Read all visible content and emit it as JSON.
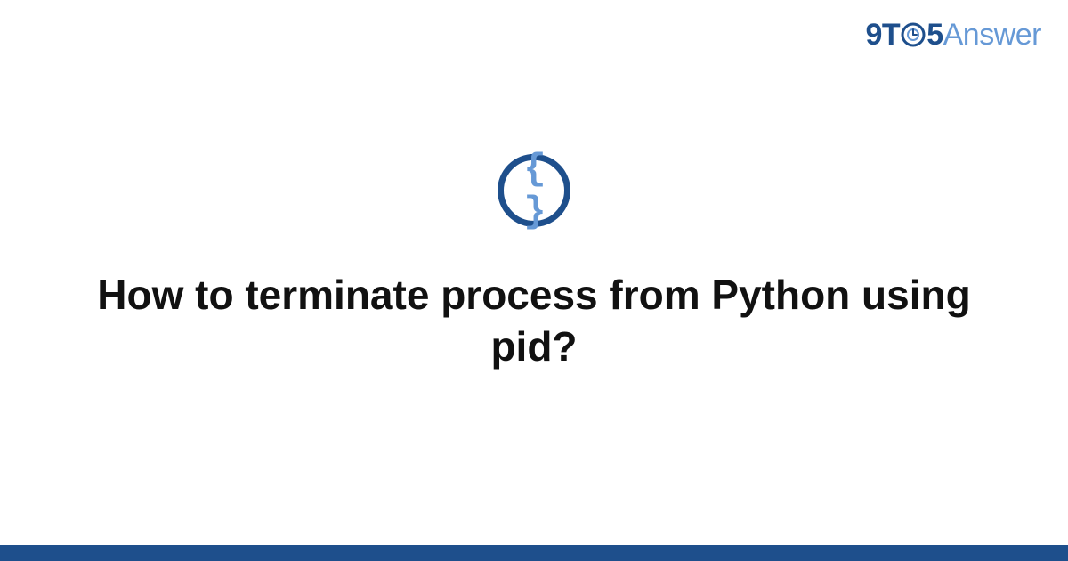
{
  "logo": {
    "part1": "9T",
    "part2": "5",
    "part3": "Answer"
  },
  "icon": {
    "braces": "{ }"
  },
  "title": "How to terminate process from Python using pid?",
  "colors": {
    "primary": "#1e4f8c",
    "accent": "#6699d6"
  }
}
